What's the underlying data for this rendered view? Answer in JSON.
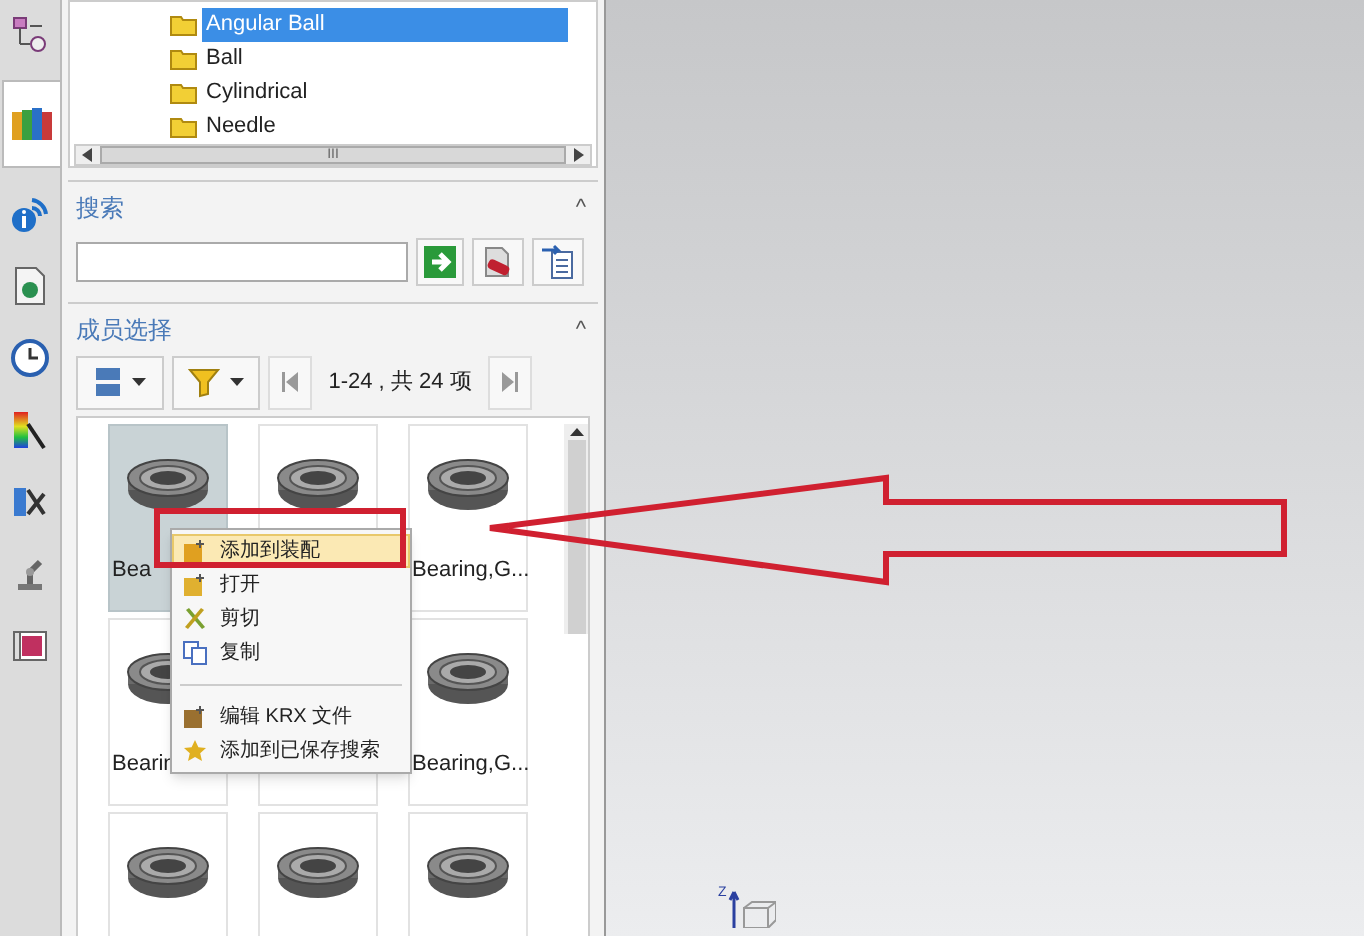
{
  "sidebar_tabs": [
    {
      "selected": false
    },
    {
      "selected": true
    },
    {
      "selected": false
    },
    {
      "selected": false
    },
    {
      "selected": false
    },
    {
      "selected": false
    },
    {
      "selected": false
    },
    {
      "selected": false
    },
    {
      "selected": false
    }
  ],
  "tree": {
    "items": [
      {
        "label": "Angular Ball",
        "selected": true
      },
      {
        "label": "Ball",
        "selected": false
      },
      {
        "label": "Cylindrical",
        "selected": false
      },
      {
        "label": "Needle",
        "selected": false
      }
    ],
    "scroll_grip": "III"
  },
  "search": {
    "title": "搜索",
    "collapse": "^"
  },
  "members": {
    "title": "成员选择",
    "collapse": "^",
    "pager": "1-24 , 共 24 项",
    "tiles": [
      {
        "label": "Bea",
        "selected": true
      },
      {
        "selected": false
      },
      {
        "label": "Bearing,G...",
        "selected": false
      },
      {
        "label": "Bearin",
        "selected": false
      },
      {
        "selected": false
      },
      {
        "label": "Bearing,G...",
        "selected": false
      },
      {
        "selected": false
      },
      {
        "selected": false
      },
      {
        "selected": false
      }
    ]
  },
  "context_menu": {
    "items": [
      {
        "label": "添加到装配",
        "selected": true,
        "separator_before": false
      },
      {
        "label": "打开",
        "selected": false,
        "separator_before": false
      },
      {
        "label": "剪切",
        "selected": false,
        "separator_before": false
      },
      {
        "label": "复制",
        "selected": false,
        "separator_before": false
      },
      {
        "label": "编辑 KRX 文件",
        "selected": false,
        "separator_before": true
      },
      {
        "label": "添加到已保存搜索",
        "selected": false,
        "separator_before": false
      }
    ]
  },
  "viewport": {
    "axis_label": "Z"
  }
}
